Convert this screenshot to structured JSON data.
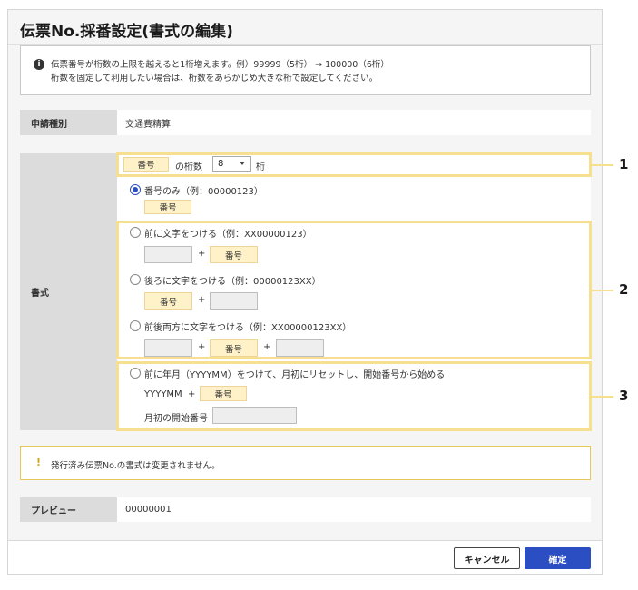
{
  "dialog": {
    "title": "伝票No.採番設定(書式の編集)",
    "info_icon": "info-icon",
    "info_lines": [
      "伝票番号が桁数の上限を越えると1桁増えます。例）99999（5桁） → 100000（6桁）",
      "桁数を固定して利用したい場合は、桁数をあらかじめ大きな桁で設定してください。"
    ]
  },
  "request_type": {
    "label": "申請種別",
    "value": "交通費精算"
  },
  "format": {
    "label": "書式",
    "number_chip": "番号",
    "digits_label": "の桁数",
    "digits_value": "8",
    "digits_unit": "桁",
    "options": [
      {
        "label": "番号のみ（例：00000123）",
        "selected": true
      },
      {
        "label": "前に文字をつける（例：XX00000123）",
        "selected": false
      },
      {
        "label": "後ろに文字をつける（例：00000123XX）",
        "selected": false
      },
      {
        "label": "前後両方に文字をつける（例：XX00000123XX）",
        "selected": false
      },
      {
        "label": "前に年月（YYYYMM）をつけて、月初にリセットし、開始番号から始める",
        "selected": false
      }
    ],
    "plus": "+",
    "yyyymm_label": "YYYYMM",
    "monthly_start_label": "月初の開始番号"
  },
  "callouts": [
    "1",
    "2",
    "3"
  ],
  "warning": {
    "icon": "exclamation-icon",
    "text": "発行済み伝票No.の書式は変更されません。"
  },
  "preview": {
    "label": "プレビュー",
    "value": "00000001"
  },
  "buttons": {
    "cancel": "キャンセル",
    "ok": "確定"
  },
  "colors": {
    "primary": "#2b4fc2",
    "chip_bg": "#fff2c8",
    "highlight": "#f6e08f",
    "warning_border": "#e6c85a"
  }
}
